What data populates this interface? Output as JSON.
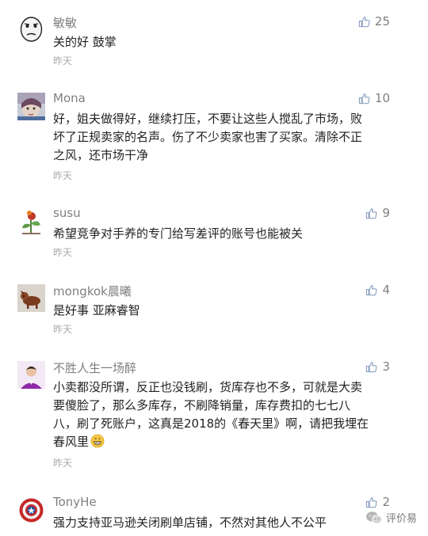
{
  "comments": [
    {
      "name": "敏敏",
      "likes": "25",
      "lines": [
        "关的好 鼓掌"
      ],
      "time": "昨天",
      "avatar": "rage-face-avatar"
    },
    {
      "name": "Mona",
      "likes": "10",
      "lines": [
        "好，姐夫做得好，继续打压，不要让这些人搅乱了市场，败",
        "坏了正规卖家的名声。伤了不少卖家也害了买家。清除不正",
        "之风，还市场干净"
      ],
      "time": "昨天",
      "avatar": "photo-avatar"
    },
    {
      "name": "susu",
      "likes": "9",
      "lines": [
        "希望竞争对手养的专门给写差评的账号也能被关"
      ],
      "time": "昨天",
      "avatar": "plant-avatar"
    },
    {
      "name": "mongkok晨曦",
      "likes": "4",
      "lines": [
        "是好事 亚麻睿智"
      ],
      "time": "昨天",
      "avatar": "dog-avatar"
    },
    {
      "name": "不胜人生一场醉",
      "likes": "3",
      "lines": [
        "小卖都没所谓，反正也没钱刷，货库存也不多，可就是大卖",
        "要傻脸了，那么多库存，不刷降销量，库存费扣的七七八",
        "八，刷了死账户，这真是2018的《春天里》啊，请把我埋在",
        "春风里"
      ],
      "time": "昨天",
      "avatar": "person-avatar",
      "emoji": "grinning-emoji"
    },
    {
      "name": "TonyHe",
      "likes": "2",
      "lines": [
        "强力支持亚马逊关闭刷单店铺，不然对其他人不公平"
      ],
      "time": "",
      "avatar": "shield-avatar"
    }
  ],
  "watermark": {
    "text": "评价易",
    "icon": "wechat-icon"
  },
  "colors": {
    "name": "#7f7f7f",
    "text": "#222222",
    "time": "#aaaaaa",
    "like_icon": "#8aa0bf"
  }
}
